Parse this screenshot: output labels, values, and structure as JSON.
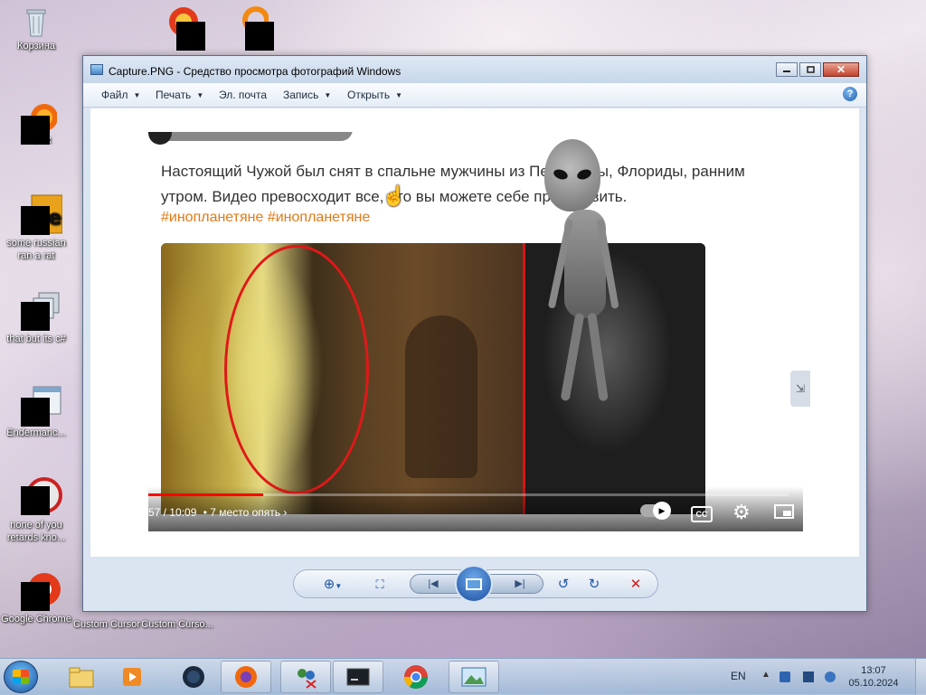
{
  "desktop": {
    "icons": [
      {
        "label": "Корзина"
      },
      {
        "label": "Firefox"
      },
      {
        "label": "some russian ran a rat"
      },
      {
        "label": "that but its c#"
      },
      {
        "label": "Endermanc..."
      },
      {
        "label": "none of you retards kno..."
      },
      {
        "label": "Google Chrome"
      },
      {
        "label": "Custom Cursor"
      },
      {
        "label": "Custom Curso..."
      }
    ]
  },
  "window": {
    "title": "Capture.PNG - Средство просмотра фотографий Windows",
    "menu": [
      {
        "label": "Файл"
      },
      {
        "label": "Печать"
      },
      {
        "label": "Эл. почта"
      },
      {
        "label": "Запись"
      },
      {
        "label": "Открыть"
      }
    ],
    "help_label": "?"
  },
  "capture": {
    "post_text": "Настоящий Чужой был снят в спальне мужчины из Пенсаколы, Флориды, ранним утром. Видео превосходит все, что вы можете себе представить.",
    "hashtags": "#инопланетяне #инопланетяне",
    "video": {
      "time": "57 / 10:09",
      "chapter": "• 7 место опять ›",
      "progress": 0.18,
      "cc_label": "CC"
    }
  },
  "taskbar": {
    "language": "EN",
    "time": "13:07",
    "date": "05.10.2024"
  },
  "colors": {
    "hashtag": "#e27a16",
    "progress": "#ff0000",
    "oval": "#e01818"
  }
}
